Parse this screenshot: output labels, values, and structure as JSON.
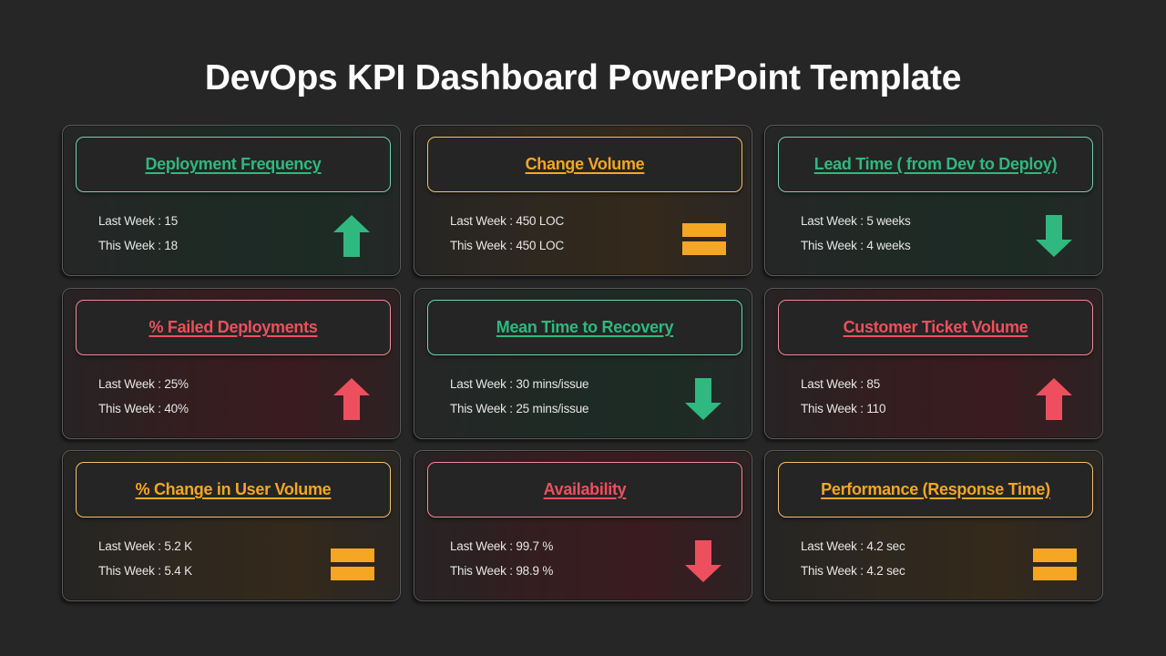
{
  "title": "DevOps KPI Dashboard PowerPoint Template",
  "colors": {
    "green": "#2fb87f",
    "red": "#ee4f5e",
    "amber": "#f5a623",
    "background": "#262626"
  },
  "cards": [
    {
      "title": "Deployment Frequency",
      "status": "green",
      "trend": "up-arrow-icon",
      "last_week": "Last Week : 15",
      "this_week": "This Week : 18"
    },
    {
      "title": "Change Volume",
      "status": "amber",
      "trend": "equals-icon",
      "last_week": "Last Week : 450 LOC",
      "this_week": "This Week : 450 LOC"
    },
    {
      "title": "Lead Time ( from Dev to Deploy)",
      "status": "green",
      "trend": "down-arrow-icon",
      "last_week": "Last Week : 5 weeks",
      "this_week": "This Week : 4 weeks"
    },
    {
      "title": "% Failed Deployments",
      "status": "red",
      "trend": "up-arrow-icon",
      "last_week": "Last Week : 25%",
      "this_week": "This Week : 40%"
    },
    {
      "title": "Mean Time to Recovery",
      "status": "green",
      "trend": "down-arrow-icon",
      "last_week": "Last Week : 30 mins/issue",
      "this_week": "This Week : 25 mins/issue"
    },
    {
      "title": "Customer Ticket Volume",
      "status": "red",
      "trend": "up-arrow-icon",
      "last_week": "Last Week : 85",
      "this_week": "This Week : 110"
    },
    {
      "title": "% Change in User Volume",
      "status": "amber",
      "trend": "equals-icon",
      "last_week": "Last Week : 5.2 K",
      "this_week": "This Week : 5.4 K"
    },
    {
      "title": "Availability",
      "status": "red",
      "trend": "down-arrow-icon",
      "last_week": "Last Week : 99.7 %",
      "this_week": "This Week : 98.9 %"
    },
    {
      "title": "Performance (Response Time)",
      "status": "amber",
      "trend": "equals-icon",
      "last_week": "Last Week : 4.2 sec",
      "this_week": "This Week : 4.2 sec"
    }
  ]
}
